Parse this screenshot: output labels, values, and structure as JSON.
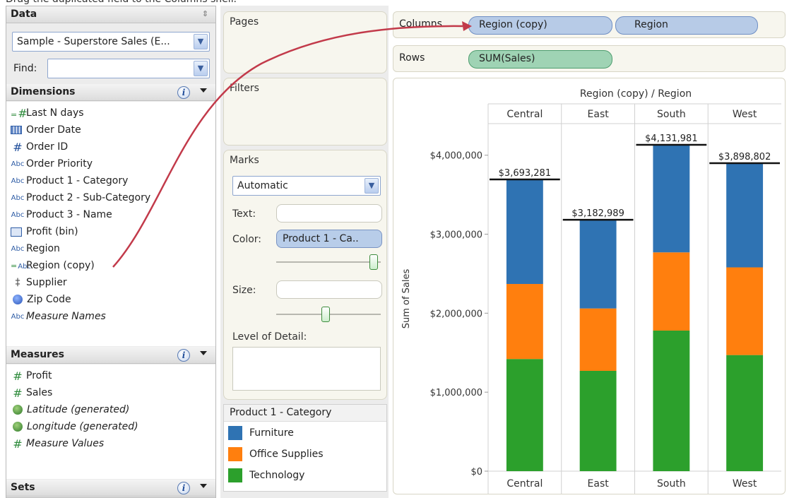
{
  "instruction": "Drag the duplicated field to the Columns shelf.",
  "data_panel": {
    "title": "Data",
    "datasource": "Sample - Superstore Sales (E...",
    "find_label": "Find:",
    "find_value": ""
  },
  "dimensions": {
    "title": "Dimensions",
    "items": [
      {
        "icon": "calc-hash-icon",
        "label": "Last N days"
      },
      {
        "icon": "calendar-icon",
        "label": "Order Date"
      },
      {
        "icon": "hash-icon",
        "label": "Order ID"
      },
      {
        "icon": "abc-icon",
        "label": "Order Priority"
      },
      {
        "icon": "abc-icon",
        "label": "Product 1 - Category"
      },
      {
        "icon": "abc-icon",
        "label": "Product 2 - Sub-Category"
      },
      {
        "icon": "abc-icon",
        "label": "Product 3 - Name"
      },
      {
        "icon": "bin-icon",
        "label": "Profit (bin)"
      },
      {
        "icon": "abc-icon",
        "label": "Region"
      },
      {
        "icon": "calc-abc-icon",
        "label": "Region (copy)"
      },
      {
        "icon": "paperclip-icon",
        "label": "Supplier"
      },
      {
        "icon": "globe-icon",
        "label": "Zip Code"
      },
      {
        "icon": "abc-icon",
        "label": "Measure Names"
      }
    ]
  },
  "measures": {
    "title": "Measures",
    "items": [
      {
        "icon": "hash-icon",
        "label": "Profit"
      },
      {
        "icon": "hash-icon",
        "label": "Sales"
      },
      {
        "icon": "globe-icon",
        "label": "Latitude (generated)"
      },
      {
        "icon": "globe-icon",
        "label": "Longitude (generated)"
      },
      {
        "icon": "hash-icon",
        "label": "Measure Values"
      }
    ]
  },
  "sets": {
    "title": "Sets"
  },
  "cards": {
    "pages": "Pages",
    "filters": "Filters",
    "marks": {
      "title": "Marks",
      "type": "Automatic",
      "text_label": "Text:",
      "color_label": "Color:",
      "color_value": "Product 1 - Ca..",
      "size_label": "Size:",
      "lod_label": "Level of Detail:"
    }
  },
  "legend": {
    "title": "Product 1 - Category",
    "items": [
      {
        "label": "Furniture",
        "color": "#2f73b3"
      },
      {
        "label": "Office Supplies",
        "color": "#ff7f0e"
      },
      {
        "label": "Technology",
        "color": "#2ca02c"
      }
    ]
  },
  "shelves": {
    "columns_label": "Columns",
    "columns_pills": [
      "Region (copy)",
      "Region"
    ],
    "rows_label": "Rows",
    "rows_pills": [
      "SUM(Sales)"
    ]
  },
  "chart_data": {
    "type": "bar",
    "stacked": true,
    "title": "Region (copy) / Region",
    "ylabel": "Sum of Sales",
    "categories": [
      "Central",
      "East",
      "South",
      "West"
    ],
    "ylim": [
      0,
      4400000
    ],
    "yticks": [
      0,
      1000000,
      2000000,
      3000000,
      4000000
    ],
    "ytick_labels": [
      "$0",
      "$1,000,000",
      "$2,000,000",
      "$3,000,000",
      "$4,000,000"
    ],
    "series": [
      {
        "name": "Technology",
        "color": "#2ca02c",
        "values": [
          1420000,
          1270000,
          1780000,
          1470000
        ]
      },
      {
        "name": "Office Supplies",
        "color": "#ff7f0e",
        "values": [
          950000,
          790000,
          990000,
          1110000
        ]
      },
      {
        "name": "Furniture",
        "color": "#2f73b3",
        "values": [
          1323281,
          1122989,
          1361981,
          1318802
        ]
      }
    ],
    "totals": [
      3693281,
      3182989,
      4131981,
      3898802
    ],
    "total_labels": [
      "$3,693,281",
      "$3,182,989",
      "$4,131,981",
      "$3,898,802"
    ],
    "grid": false,
    "legend": "separate-card"
  }
}
